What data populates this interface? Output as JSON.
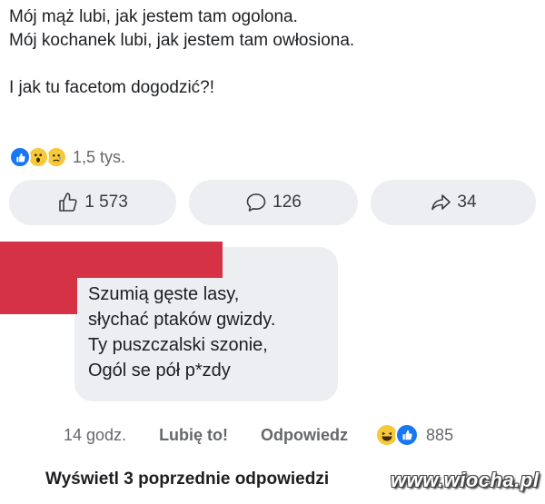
{
  "post": {
    "lines": [
      "Mój mąż lubi, jak jestem tam ogolona.",
      "Mój kochanek lubi, jak jestem tam owłosiona.",
      "I jak tu facetom dogodzić?!"
    ]
  },
  "reactions": {
    "icons": [
      "like-icon",
      "wow-emoji-icon",
      "sad-emoji-icon"
    ],
    "count": "1,5 tys."
  },
  "actions": {
    "like_count": "1 573",
    "comment_count": "126",
    "share_count": "34"
  },
  "comment": {
    "lines": [
      "Szumią gęste lasy,",
      "słychać ptaków gwizdy.",
      "Ty puszczalski szonie,",
      "Ogól se pół p*zdy"
    ],
    "time": "14 godz.",
    "like_label": "Lubię to!",
    "reply_label": "Odpowiedz",
    "reaction_icons": [
      "haha-emoji-icon",
      "like-icon"
    ],
    "reaction_count": "885"
  },
  "view_previous_label": "Wyświetl 3 poprzednie odpowiedzi",
  "watermark": "www.wiocha.pl",
  "colors": {
    "redaction": "#d63246",
    "like_blue": "#1877f2",
    "pill_bg": "#eceef1",
    "secondary_text": "#65676b"
  }
}
